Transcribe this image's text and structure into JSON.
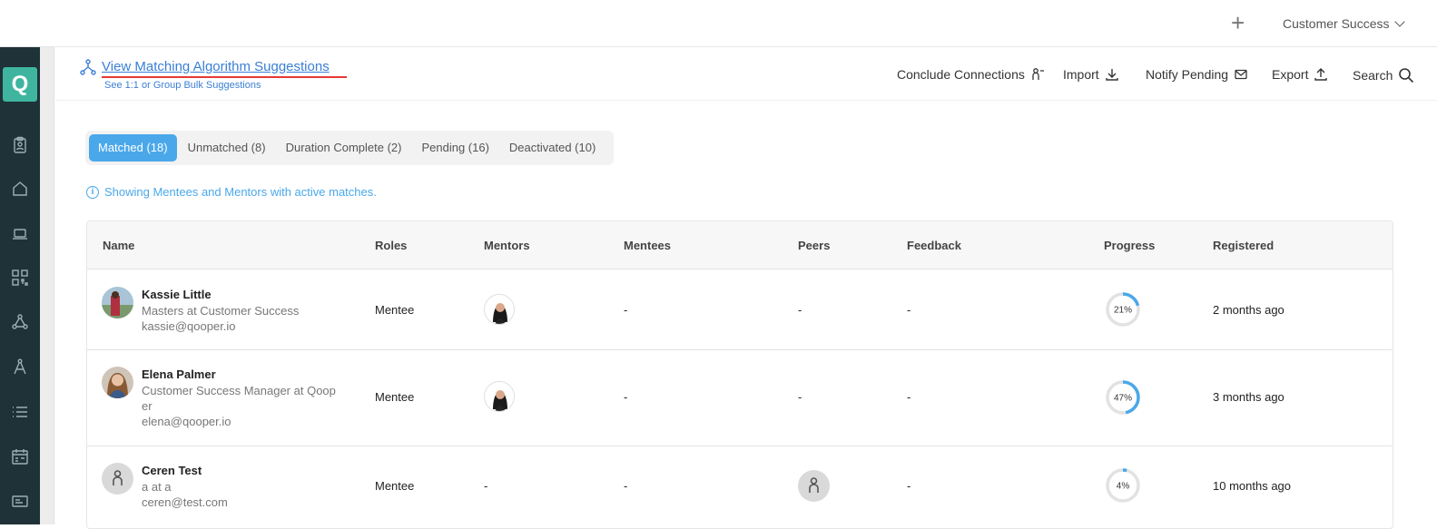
{
  "topbar": {
    "add_icon": "plus-icon",
    "org_name": "Customer Success"
  },
  "sidebar": {
    "logo": "Q",
    "icons": [
      "clipboard-icon",
      "home-icon",
      "laptop-icon",
      "qr-code-icon",
      "connections-icon",
      "compass-icon",
      "list-icon",
      "calendar-icon",
      "id-card-icon"
    ]
  },
  "subheader": {
    "matching_link": "View Matching Algorithm Suggestions",
    "matching_sub": "See 1:1 or Group Bulk Suggestions",
    "actions": {
      "conclude": "Conclude Connections",
      "import": "Import",
      "notify": "Notify Pending",
      "export": "Export",
      "search": "Search"
    }
  },
  "tabs": [
    {
      "label": "Matched (18)",
      "active": true
    },
    {
      "label": "Unmatched (8)",
      "active": false
    },
    {
      "label": "Duration Complete (2)",
      "active": false
    },
    {
      "label": "Pending (16)",
      "active": false
    },
    {
      "label": "Deactivated (10)",
      "active": false
    }
  ],
  "info_text": "Showing Mentees and Mentors with active matches.",
  "table": {
    "headers": {
      "name": "Name",
      "roles": "Roles",
      "mentors": "Mentors",
      "mentees": "Mentees",
      "peers": "Peers",
      "feedback": "Feedback",
      "progress": "Progress",
      "registered": "Registered"
    },
    "rows": [
      {
        "name": "Kassie Little",
        "title": "Masters at Customer Success",
        "email": "kassie@qooper.io",
        "role": "Mentee",
        "mentees": "-",
        "peers": "-",
        "feedback": "-",
        "progress": 21,
        "progress_label": "21%",
        "registered": "2 months ago"
      },
      {
        "name": "Elena Palmer",
        "title": "Customer Success Manager at Qoop er",
        "email": "elena@qooper.io",
        "role": "Mentee",
        "mentees": "-",
        "peers": "-",
        "feedback": "-",
        "progress": 47,
        "progress_label": "47%",
        "registered": "3 months ago"
      },
      {
        "name": "Ceren Test",
        "title": "a at a",
        "email": "ceren@test.com",
        "role": "Mentee",
        "mentors": "-",
        "mentees": "-",
        "feedback": "-",
        "progress": 4,
        "progress_label": "4%",
        "registered": "10 months ago"
      }
    ]
  },
  "colors": {
    "accent": "#4aa8ea",
    "sidebar": "#1f3238",
    "logo": "#3fb5a0",
    "link": "#3a7fd5",
    "highlight": "#e53935"
  }
}
